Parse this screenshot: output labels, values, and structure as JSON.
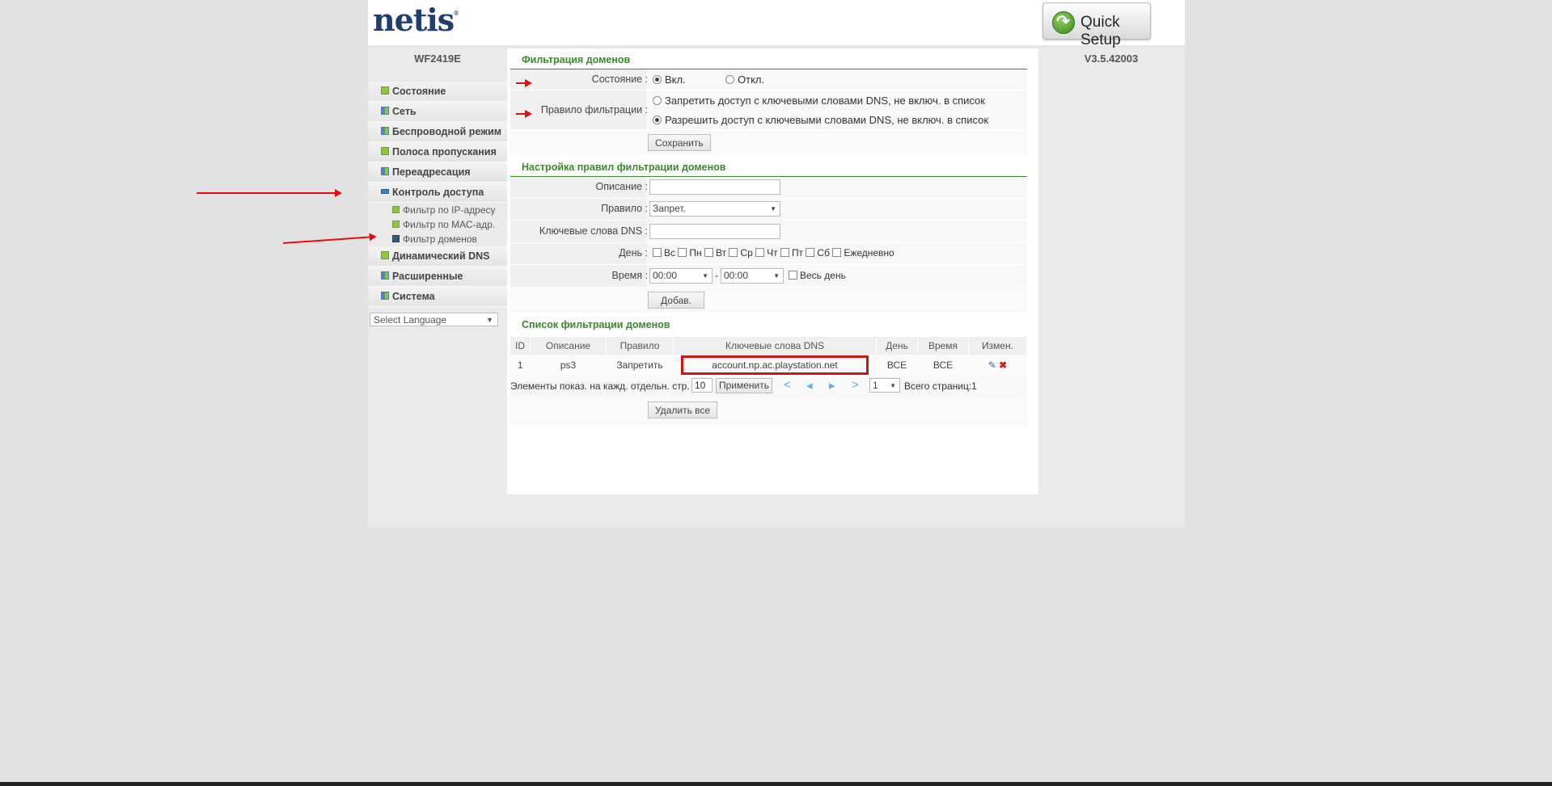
{
  "header": {
    "logo_text": "netis",
    "logo_mark": "®",
    "quick_setup_label": "Quick Setup",
    "model": "WF2419E",
    "version": "V3.5.42003"
  },
  "menu": {
    "items": [
      {
        "label": "Состояние"
      },
      {
        "label": "Сеть"
      },
      {
        "label": "Беспроводной режим"
      },
      {
        "label": "Полоса пропускания"
      },
      {
        "label": "Переадресация"
      },
      {
        "label": "Контроль доступа"
      },
      {
        "label": "Динамический DNS"
      },
      {
        "label": "Расширенные"
      },
      {
        "label": "Система"
      }
    ],
    "subitems": [
      {
        "label": "Фильтр по IP-адресу"
      },
      {
        "label": "Фильтр по МАС-адр."
      },
      {
        "label": "Фильтр доменов"
      }
    ],
    "language_select": "Select Language"
  },
  "domain_filter": {
    "title": "Фильтрация доменов",
    "state_label": "Состояние :",
    "state_on": "Вкл.",
    "state_off": "Откл.",
    "state_value": "on",
    "rule_label": "Правило фильтрации :",
    "rule_deny": "Запретить доступ с ключевыми словами DNS, не включ. в список",
    "rule_allow": "Разрешить доступ с ключевыми словами DNS, не включ. в список",
    "rule_value": "allow",
    "save_button": "Сохранить"
  },
  "rule_settings": {
    "title": "Настройка правил фильтрации доменов",
    "description_label": "Описание :",
    "description_value": "",
    "rule_label": "Правило :",
    "rule_value": "Запрет.",
    "keywords_label": "Ключевые слова DNS :",
    "keywords_value": "",
    "day_label": "День :",
    "days": [
      "Вс",
      "Пн",
      "Вт",
      "Ср",
      "Чт",
      "Пт",
      "Сб",
      "Ежедневно"
    ],
    "time_label": "Время :",
    "time_from": "00:00",
    "time_sep": "-",
    "time_to": "00:00",
    "all_day": "Весь день",
    "add_button": "Добав."
  },
  "filter_list": {
    "title": "Список фильтрации доменов",
    "columns": [
      "ID",
      "Описание",
      "Правило",
      "Ключевые слова DNS",
      "День",
      "Время",
      "Измен."
    ],
    "rows": [
      {
        "id": "1",
        "description": "ps3",
        "rule": "Запретить",
        "keywords": "account.np.ac.playstation.net",
        "day": "ВСЕ",
        "time": "ВСЕ"
      }
    ],
    "per_page_label": "Элементы показ. на кажд. отдельн. стр.",
    "per_page_value": "10",
    "apply_button": "Применить",
    "page_value": "1",
    "total_pages": "Всего страниц:1",
    "delete_all_button": "Удалить все"
  },
  "colors": {
    "section_title": "#3a8a2a",
    "annotation_red": "#e01010",
    "logo_blue": "#1f3e6e"
  }
}
